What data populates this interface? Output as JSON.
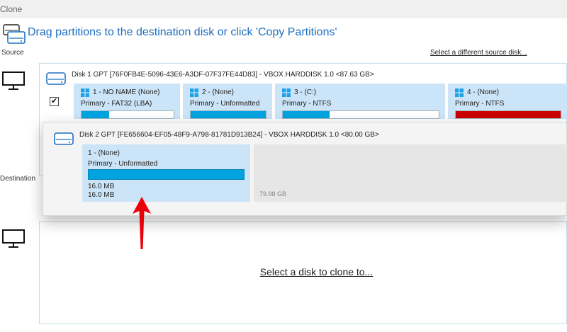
{
  "window": {
    "title": "Clone"
  },
  "header": {
    "text": "Drag partitions to the destination disk or click 'Copy Partitions'"
  },
  "source": {
    "label": "Source",
    "change_link": "Select a different source disk...",
    "disk_title": "Disk 1 GPT [76F0FB4E-5096-43E6-A3DF-07F37FE44D83] - VBOX HARDDISK 1.0  <87.63 GB>",
    "checked": "✔",
    "partitions": [
      {
        "name": "1 -  NO NAME (None)",
        "type": "Primary - FAT32 (LBA)",
        "fill_fraction": 0.3,
        "fill_color": "#00a3e0"
      },
      {
        "name": "2 -  (None)",
        "type": "Primary - Unformatted",
        "fill_fraction": 1.0,
        "fill_color": "#00a3e0"
      },
      {
        "name": "3 -  (C:)",
        "type": "Primary - NTFS",
        "fill_fraction": 0.3,
        "fill_color": "#00a3e0"
      },
      {
        "name": "4 -  (None)",
        "type": "Primary - NTFS",
        "fill_fraction": 1.0,
        "fill_color": "#cc0000"
      }
    ]
  },
  "destination": {
    "label": "Destination",
    "select_link": "Select a disk to clone to..."
  },
  "drag": {
    "disk_title": "Disk 2 GPT [FE656604-EF05-48F9-A798-81781D913B24] - VBOX HARDDISK 1.0  <80.00 GB>",
    "partition": {
      "name": "1 -  (None)",
      "type": "Primary - Unformatted",
      "size1": "16.0 MB",
      "size2": "16.0 MB"
    },
    "unallocated": "79.98 GB"
  },
  "colors": {
    "accent": "#1e6fc0",
    "partition_bg": "#cce4f7",
    "bar_blue": "#00a3e0",
    "bar_red": "#cc0000",
    "arrow": "#e8000b"
  },
  "icons": [
    "disk-stack-icon",
    "monitor-icon",
    "hard-disk-icon",
    "windows-logo-icon",
    "checkmark-icon",
    "red-arrow-icon"
  ]
}
